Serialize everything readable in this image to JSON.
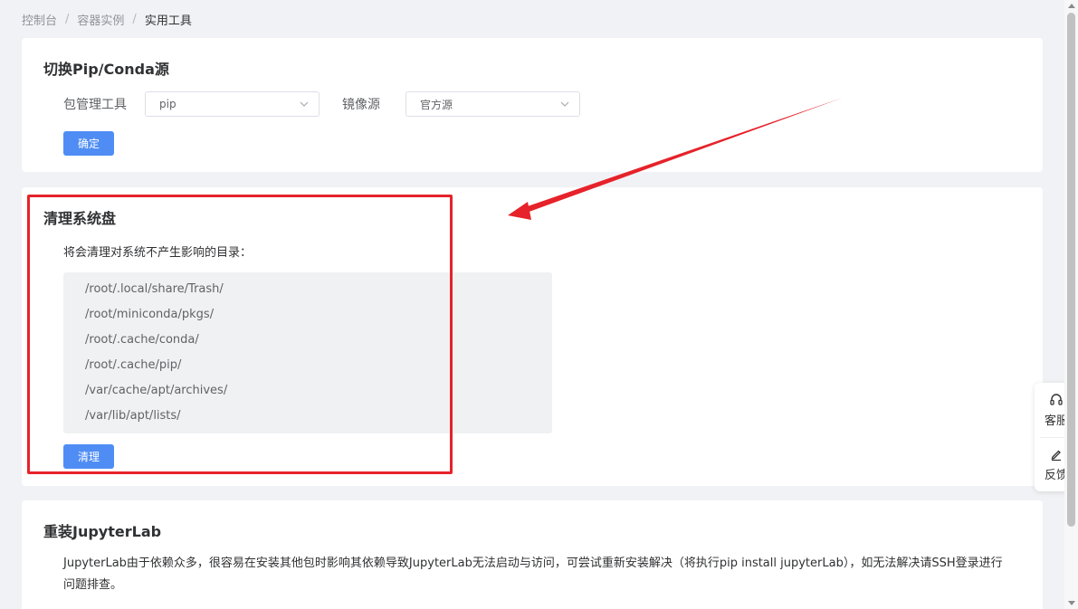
{
  "breadcrumb": {
    "items": [
      "控制台",
      "容器实例",
      "实用工具"
    ],
    "separator": "/"
  },
  "mirror_card": {
    "title": "切换Pip/Conda源",
    "package_tool_label": "包管理工具",
    "package_tool_value": "pip",
    "mirror_label": "镜像源",
    "mirror_value": "官方源",
    "confirm_label": "确定"
  },
  "clean_card": {
    "title": "清理系统盘",
    "description": "将会清理对系统不产生影响的目录：",
    "paths": [
      "/root/.local/share/Trash/",
      "/root/miniconda/pkgs/",
      "/root/.cache/conda/",
      "/root/.cache/pip/",
      "/var/cache/apt/archives/",
      "/var/lib/apt/lists/"
    ],
    "clean_label": "清理"
  },
  "jupyter_card": {
    "title": "重装JupyterLab",
    "description": "JupyterLab由于依赖众多，很容易在安装其他包时影响其依赖导致JupyterLab无法启动与访问，可尝试重新安装解决（将执行pip install jupyterLab），如无法解决请SSH登录进行问题排查。"
  },
  "side_panel": {
    "service_label": "客服",
    "feedback_label": "反馈"
  },
  "colors": {
    "primary": "#4f8df5",
    "annotation": "#e6222a",
    "background": "#f1f2f5"
  },
  "icons": {
    "service": "headset-icon",
    "feedback": "pencil-icon",
    "dropdown": "chevron-down-icon"
  }
}
